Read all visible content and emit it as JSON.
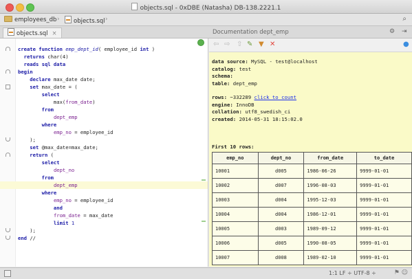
{
  "window": {
    "title": "objects.sql - 0xDBE (Natasha) DB-138.2221.1"
  },
  "nav": {
    "breadcrumbs": [
      "employees_db",
      "objects.sql"
    ]
  },
  "tabs": [
    {
      "label": "objects.sql"
    }
  ],
  "doc": {
    "title": "Documentation dept_emp",
    "info_lines": [
      {
        "label": "data source:",
        "value": "MySQL - test@localhost"
      },
      {
        "label": "catalog:",
        "value": "test"
      },
      {
        "label": "schema:",
        "value": ""
      },
      {
        "label": "table:",
        "value": "dept_emp"
      }
    ],
    "rows_label": "rows:",
    "rows_value": "~332289",
    "count_link": "click to count",
    "detail_lines": [
      {
        "label": "engine:",
        "value": "InnoDB"
      },
      {
        "label": "collation:",
        "value": "utf8_swedish_ci"
      },
      {
        "label": "created:",
        "value": "2014-05-31 18:15:02.0"
      }
    ],
    "first_rows_label": "First 10 rows:",
    "table": {
      "columns": [
        "emp_no",
        "dept_no",
        "from_date",
        "to_date"
      ],
      "rows": [
        [
          "10001",
          "d005",
          "1986-06-26",
          "9999-01-01"
        ],
        [
          "10002",
          "d007",
          "1996-08-03",
          "9999-01-01"
        ],
        [
          "10003",
          "d004",
          "1995-12-03",
          "9999-01-01"
        ],
        [
          "10004",
          "d004",
          "1986-12-01",
          "9999-01-01"
        ],
        [
          "10005",
          "d003",
          "1989-09-12",
          "9999-01-01"
        ],
        [
          "10006",
          "d005",
          "1990-08-05",
          "9999-01-01"
        ],
        [
          "10007",
          "d008",
          "1989-02-10",
          "9999-01-01"
        ]
      ]
    }
  },
  "code": [
    [
      {
        "t": "create function ",
        "c": "kw"
      },
      {
        "t": "emp_dept_id",
        "c": "fn"
      },
      {
        "t": "( employee_id ",
        "c": ""
      },
      {
        "t": "int",
        "c": "kw"
      },
      {
        "t": " )",
        "c": ""
      }
    ],
    [
      {
        "t": "  returns ",
        "c": "kw"
      },
      {
        "t": "char(4)",
        "c": ""
      }
    ],
    [
      {
        "t": "  reads sql data",
        "c": "kw"
      }
    ],
    [
      {
        "t": "begin",
        "c": "kw"
      }
    ],
    [
      {
        "t": "    declare ",
        "c": "kw"
      },
      {
        "t": "max_date date;",
        "c": ""
      }
    ],
    [
      {
        "t": "    set ",
        "c": "kw"
      },
      {
        "t": "max_date = (",
        "c": ""
      }
    ],
    [
      {
        "t": "        select",
        "c": "kw"
      }
    ],
    [
      {
        "t": "            max(",
        "c": ""
      },
      {
        "t": "from_date",
        "c": "pk"
      },
      {
        "t": ")",
        "c": ""
      }
    ],
    [
      {
        "t": "        from",
        "c": "kw"
      }
    ],
    [
      {
        "t": "            ",
        "c": ""
      },
      {
        "t": "dept_emp",
        "c": "pk"
      }
    ],
    [
      {
        "t": "        where",
        "c": "kw"
      }
    ],
    [
      {
        "t": "            ",
        "c": ""
      },
      {
        "t": "emp_no",
        "c": "pk"
      },
      {
        "t": " = employee_id",
        "c": ""
      }
    ],
    [
      {
        "t": "    );",
        "c": ""
      }
    ],
    [
      {
        "t": "    set ",
        "c": "kw"
      },
      {
        "t": "@max_date=max_date;",
        "c": ""
      }
    ],
    [
      {
        "t": "    return ",
        "c": "kw"
      },
      {
        "t": "(",
        "c": ""
      }
    ],
    [
      {
        "t": "        select",
        "c": "kw"
      }
    ],
    [
      {
        "t": "            ",
        "c": ""
      },
      {
        "t": "dept_no",
        "c": "pk"
      }
    ],
    [
      {
        "t": "        from",
        "c": "kw"
      }
    ],
    [
      {
        "t": "            ",
        "c": ""
      },
      {
        "t": "dept_emp",
        "c": "pk"
      }
    ],
    [
      {
        "t": "        where",
        "c": "kw"
      }
    ],
    [
      {
        "t": "            ",
        "c": ""
      },
      {
        "t": "emp_no",
        "c": "pk"
      },
      {
        "t": " = employee_id",
        "c": ""
      }
    ],
    [
      {
        "t": "            and",
        "c": "kw"
      }
    ],
    [
      {
        "t": "            ",
        "c": ""
      },
      {
        "t": "from_date",
        "c": "pk"
      },
      {
        "t": " = max_date",
        "c": ""
      }
    ],
    [
      {
        "t": "            limit ",
        "c": "kw"
      },
      {
        "t": "1",
        "c": "num"
      }
    ],
    [
      {
        "t": "    );",
        "c": ""
      }
    ],
    [
      {
        "t": "end ",
        "c": "kw"
      },
      {
        "t": "//",
        "c": ""
      }
    ]
  ],
  "status": {
    "text": "1:1   LF ÷   UTF-8 ÷"
  },
  "colors": {
    "keyword": "#1a1aa6",
    "identifier": "#7a1f8f",
    "doc_background": "#fafac8",
    "current_line": "#fcfad6",
    "link": "#1b2eea"
  }
}
